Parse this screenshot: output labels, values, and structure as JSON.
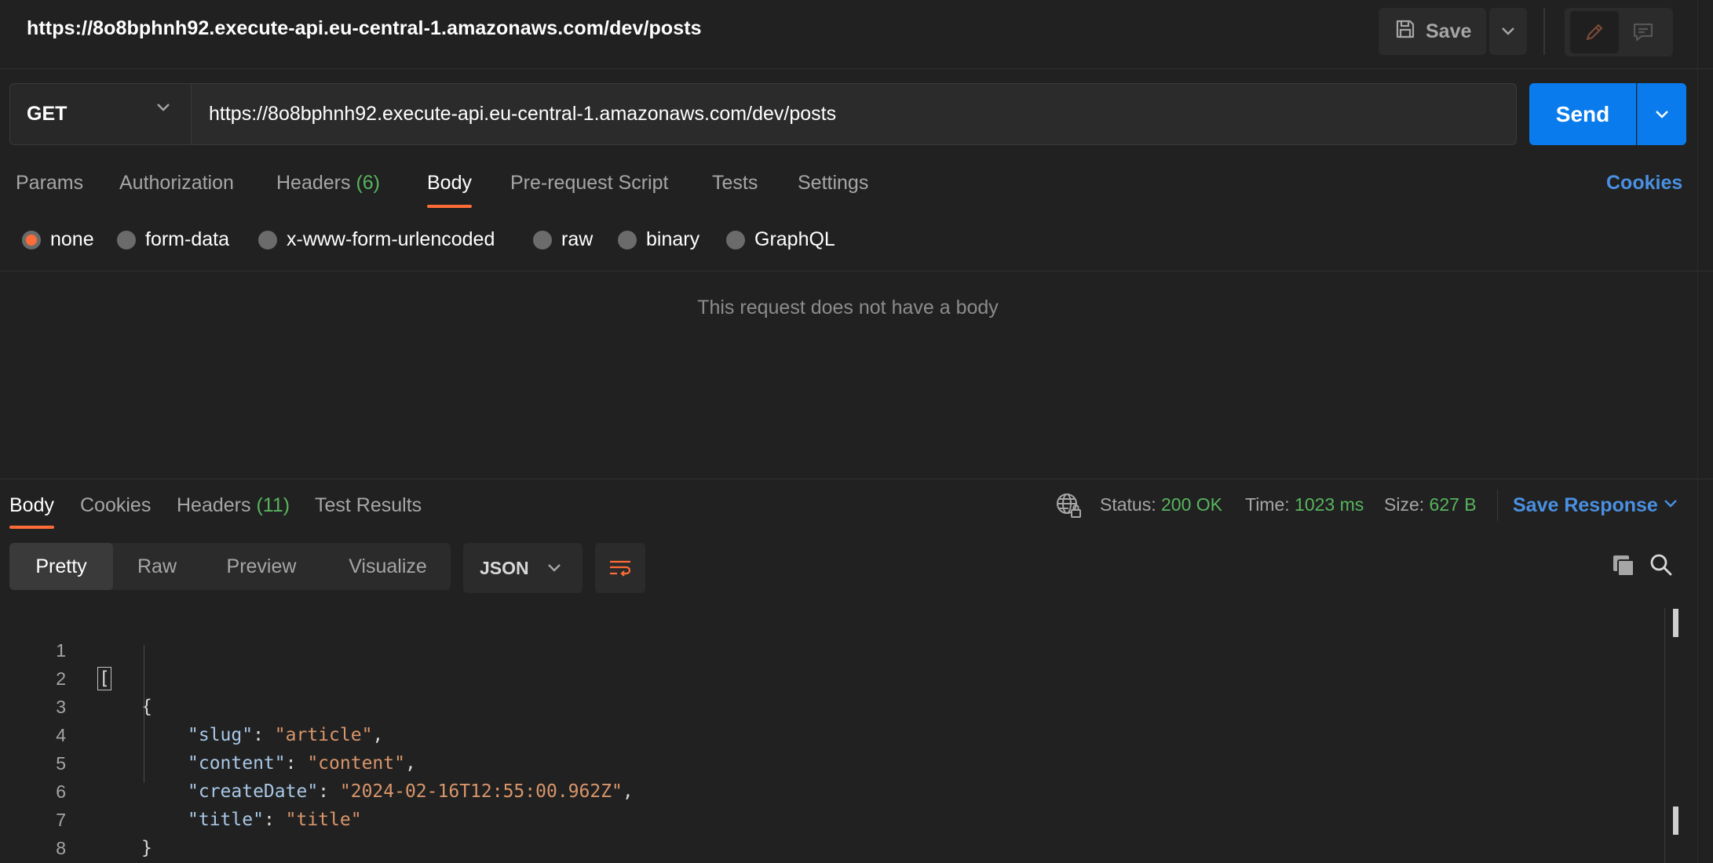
{
  "header": {
    "request_title": "https://8o8bphnh92.execute-api.eu-central-1.amazonaws.com/dev/posts",
    "save_label": "Save",
    "icons": [
      "save-icon",
      "chevron-down-icon",
      "pencil-icon",
      "comment-icon"
    ]
  },
  "request": {
    "method": "GET",
    "url": "https://8o8bphnh92.execute-api.eu-central-1.amazonaws.com/dev/posts",
    "send_label": "Send"
  },
  "request_tabs": {
    "params": "Params",
    "authorization": "Authorization",
    "headers": "Headers",
    "headers_count": "(6)",
    "body": "Body",
    "prerequest": "Pre-request Script",
    "tests": "Tests",
    "settings": "Settings",
    "active": "Body",
    "cookies": "Cookies"
  },
  "body_types": {
    "none": "none",
    "form_data": "form-data",
    "urlencoded": "x-www-form-urlencoded",
    "raw": "raw",
    "binary": "binary",
    "graphql": "GraphQL",
    "selected": "none",
    "empty_message": "This request does not have a body"
  },
  "response": {
    "tabs": {
      "body": "Body",
      "cookies": "Cookies",
      "headers": "Headers",
      "headers_count": "(11)",
      "test_results": "Test Results",
      "active": "Body"
    },
    "status_label": "Status:",
    "status_value": "200 OK",
    "time_label": "Time:",
    "time_value": "1023 ms",
    "size_label": "Size:",
    "size_value": "627 B",
    "save_response": "Save Response",
    "views": {
      "pretty": "Pretty",
      "raw": "Raw",
      "preview": "Preview",
      "visualize": "Visualize",
      "active": "Pretty"
    },
    "format": "JSON",
    "colors": {
      "accent": "#ff6c37",
      "success": "#57b55e",
      "link": "#4a90e2",
      "send": "#097bed"
    }
  },
  "code": {
    "lines": [
      {
        "n": "1",
        "open_bracket": "["
      },
      {
        "n": "2",
        "text": "{"
      },
      {
        "n": "3",
        "key": "\"slug\"",
        "value": "\"article\"",
        "trail": ","
      },
      {
        "n": "4",
        "key": "\"content\"",
        "value": "\"content\"",
        "trail": ","
      },
      {
        "n": "5",
        "key": "\"createDate\"",
        "value": "\"2024-02-16T12:55:00.962Z\"",
        "trail": ","
      },
      {
        "n": "6",
        "key": "\"title\"",
        "value": "\"title\"",
        "trail": ""
      },
      {
        "n": "7",
        "text": "}"
      },
      {
        "n": "8",
        "close_bracket": "]"
      }
    ]
  }
}
